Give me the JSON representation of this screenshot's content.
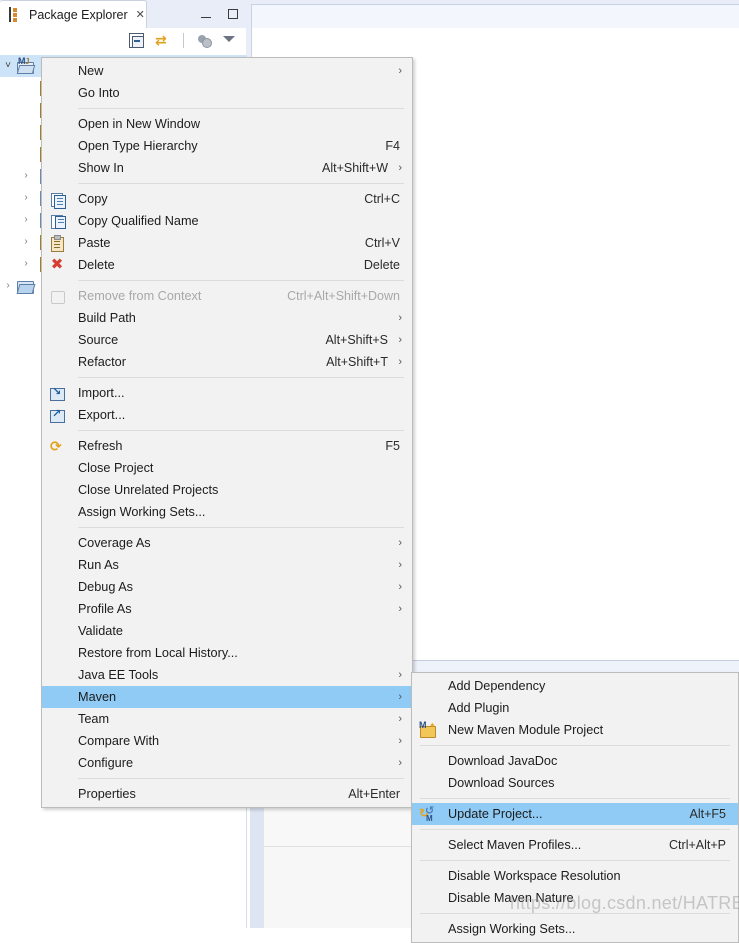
{
  "app": {
    "view_title": "Package Explorer",
    "view_tab_close": "✕",
    "minimize_label": "Minimize",
    "maximize_label": "Maximize"
  },
  "view_toolbar": {
    "items": [
      {
        "name": "collapse-all-icon",
        "tooltip": "Collapse All"
      },
      {
        "name": "link-with-editor-icon",
        "tooltip": "Link with Editor"
      },
      {
        "name": "focus-on-active-task-icon",
        "tooltip": "Focus on Active Task"
      },
      {
        "name": "view-menu-icon",
        "tooltip": "View Menu"
      }
    ]
  },
  "tree": {
    "rows": [
      {
        "indent": 0,
        "twisty": "v",
        "icon": "maven-java-project-icon",
        "label": "",
        "selected": true
      },
      {
        "indent": 1,
        "twisty": "",
        "icon": "source-folder-icon",
        "label": ""
      },
      {
        "indent": 1,
        "twisty": "",
        "icon": "source-folder-icon",
        "label": ""
      },
      {
        "indent": 1,
        "twisty": "",
        "icon": "source-folder-icon",
        "label": ""
      },
      {
        "indent": 1,
        "twisty": "",
        "icon": "source-folder-icon",
        "label": ""
      },
      {
        "indent": 1,
        "twisty": ">",
        "icon": "library-icon",
        "label": ""
      },
      {
        "indent": 1,
        "twisty": ">",
        "icon": "library-icon",
        "label": ""
      },
      {
        "indent": 1,
        "twisty": ">",
        "icon": "library-icon",
        "label": ""
      },
      {
        "indent": 1,
        "twisty": ">",
        "icon": "folder-icon",
        "label": ""
      },
      {
        "indent": 1,
        "twisty": ">",
        "icon": "folder-icon",
        "label": ""
      },
      {
        "indent": 0,
        "twisty": ">",
        "icon": "project-folder-icon",
        "label": ""
      }
    ]
  },
  "context_menu": {
    "name": "project-context-menu",
    "items": [
      {
        "id": "new",
        "label": "New",
        "accel": "",
        "arrow": true,
        "icon": "",
        "state": "normal"
      },
      {
        "id": "go-into",
        "label": "Go Into",
        "accel": "",
        "arrow": false,
        "icon": "",
        "state": "normal"
      },
      {
        "id": "sep1",
        "type": "separator"
      },
      {
        "id": "open-in-new-window",
        "label": "Open in New Window",
        "accel": "",
        "arrow": false,
        "icon": "",
        "state": "normal"
      },
      {
        "id": "open-type-hierarchy",
        "label": "Open Type Hierarchy",
        "accel": "F4",
        "arrow": false,
        "icon": "",
        "state": "normal"
      },
      {
        "id": "show-in",
        "label": "Show In",
        "accel": "Alt+Shift+W",
        "arrow": true,
        "icon": "",
        "state": "normal"
      },
      {
        "id": "sep2",
        "type": "separator"
      },
      {
        "id": "copy",
        "label": "Copy",
        "accel": "Ctrl+C",
        "arrow": false,
        "icon": "copy-icon",
        "state": "normal"
      },
      {
        "id": "copy-qualified-name",
        "label": "Copy Qualified Name",
        "accel": "",
        "arrow": false,
        "icon": "copy-qualified-name-icon",
        "state": "normal"
      },
      {
        "id": "paste",
        "label": "Paste",
        "accel": "Ctrl+V",
        "arrow": false,
        "icon": "paste-icon",
        "state": "normal"
      },
      {
        "id": "delete",
        "label": "Delete",
        "accel": "Delete",
        "arrow": false,
        "icon": "delete-icon",
        "state": "normal"
      },
      {
        "id": "sep3",
        "type": "separator"
      },
      {
        "id": "remove-from-context",
        "label": "Remove from Context",
        "accel": "Ctrl+Alt+Shift+Down",
        "arrow": false,
        "icon": "remove-from-context-icon",
        "state": "disabled"
      },
      {
        "id": "build-path",
        "label": "Build Path",
        "accel": "",
        "arrow": true,
        "icon": "",
        "state": "normal"
      },
      {
        "id": "source",
        "label": "Source",
        "accel": "Alt+Shift+S",
        "arrow": true,
        "icon": "",
        "state": "normal"
      },
      {
        "id": "refactor",
        "label": "Refactor",
        "accel": "Alt+Shift+T",
        "arrow": true,
        "icon": "",
        "state": "normal"
      },
      {
        "id": "sep4",
        "type": "separator"
      },
      {
        "id": "import",
        "label": "Import...",
        "accel": "",
        "arrow": false,
        "icon": "import-icon",
        "state": "normal"
      },
      {
        "id": "export",
        "label": "Export...",
        "accel": "",
        "arrow": false,
        "icon": "export-icon",
        "state": "normal"
      },
      {
        "id": "sep5",
        "type": "separator"
      },
      {
        "id": "refresh",
        "label": "Refresh",
        "accel": "F5",
        "arrow": false,
        "icon": "refresh-icon",
        "state": "normal"
      },
      {
        "id": "close-project",
        "label": "Close Project",
        "accel": "",
        "arrow": false,
        "icon": "",
        "state": "normal"
      },
      {
        "id": "close-unrelated",
        "label": "Close Unrelated Projects",
        "accel": "",
        "arrow": false,
        "icon": "",
        "state": "normal"
      },
      {
        "id": "assign-working-sets",
        "label": "Assign Working Sets...",
        "accel": "",
        "arrow": false,
        "icon": "",
        "state": "normal"
      },
      {
        "id": "sep6",
        "type": "separator"
      },
      {
        "id": "coverage-as",
        "label": "Coverage As",
        "accel": "",
        "arrow": true,
        "icon": "",
        "state": "normal"
      },
      {
        "id": "run-as",
        "label": "Run As",
        "accel": "",
        "arrow": true,
        "icon": "",
        "state": "normal"
      },
      {
        "id": "debug-as",
        "label": "Debug As",
        "accel": "",
        "arrow": true,
        "icon": "",
        "state": "normal"
      },
      {
        "id": "profile-as",
        "label": "Profile As",
        "accel": "",
        "arrow": true,
        "icon": "",
        "state": "normal"
      },
      {
        "id": "validate",
        "label": "Validate",
        "accel": "",
        "arrow": false,
        "icon": "",
        "state": "normal"
      },
      {
        "id": "restore-local-history",
        "label": "Restore from Local History...",
        "accel": "",
        "arrow": false,
        "icon": "",
        "state": "normal"
      },
      {
        "id": "java-ee-tools",
        "label": "Java EE Tools",
        "accel": "",
        "arrow": true,
        "icon": "",
        "state": "normal"
      },
      {
        "id": "maven",
        "label": "Maven",
        "accel": "",
        "arrow": true,
        "icon": "",
        "state": "selected"
      },
      {
        "id": "team",
        "label": "Team",
        "accel": "",
        "arrow": true,
        "icon": "",
        "state": "normal"
      },
      {
        "id": "compare-with",
        "label": "Compare With",
        "accel": "",
        "arrow": true,
        "icon": "",
        "state": "normal"
      },
      {
        "id": "configure",
        "label": "Configure",
        "accel": "",
        "arrow": true,
        "icon": "",
        "state": "normal"
      },
      {
        "id": "sep7",
        "type": "separator"
      },
      {
        "id": "properties",
        "label": "Properties",
        "accel": "Alt+Enter",
        "arrow": false,
        "icon": "",
        "state": "normal"
      }
    ]
  },
  "maven_submenu": {
    "name": "maven-submenu",
    "items": [
      {
        "id": "add-dependency",
        "label": "Add Dependency",
        "accel": "",
        "arrow": false,
        "icon": "",
        "state": "normal"
      },
      {
        "id": "add-plugin",
        "label": "Add Plugin",
        "accel": "",
        "arrow": false,
        "icon": "",
        "state": "normal"
      },
      {
        "id": "new-maven-module",
        "label": "New Maven Module Project",
        "accel": "",
        "arrow": false,
        "icon": "maven-module-icon",
        "state": "normal"
      },
      {
        "id": "msep1",
        "type": "separator"
      },
      {
        "id": "download-javadoc",
        "label": "Download JavaDoc",
        "accel": "",
        "arrow": false,
        "icon": "",
        "state": "normal"
      },
      {
        "id": "download-sources",
        "label": "Download Sources",
        "accel": "",
        "arrow": false,
        "icon": "",
        "state": "normal"
      },
      {
        "id": "msep2",
        "type": "separator"
      },
      {
        "id": "update-project",
        "label": "Update Project...",
        "accel": "Alt+F5",
        "arrow": false,
        "icon": "update-project-icon",
        "state": "selected"
      },
      {
        "id": "msep3",
        "type": "separator"
      },
      {
        "id": "select-maven-profiles",
        "label": "Select Maven Profiles...",
        "accel": "Ctrl+Alt+P",
        "arrow": false,
        "icon": "",
        "state": "normal"
      },
      {
        "id": "msep4",
        "type": "separator"
      },
      {
        "id": "disable-workspace-res",
        "label": "Disable Workspace Resolution",
        "accel": "",
        "arrow": false,
        "icon": "",
        "state": "normal"
      },
      {
        "id": "disable-maven-nature",
        "label": "Disable Maven Nature",
        "accel": "",
        "arrow": false,
        "icon": "",
        "state": "normal"
      },
      {
        "id": "msep5",
        "type": "separator"
      },
      {
        "id": "assign-working-sets-mvn",
        "label": "Assign Working Sets...",
        "accel": "",
        "arrow": false,
        "icon": "",
        "state": "normal"
      }
    ]
  },
  "watermark": {
    "text": "https://blog.csdn.net/HATREDQAQ"
  },
  "colors": {
    "menu_background": "#f2f2f2",
    "menu_border": "#bcbcbc",
    "selection_blue": "#8fcbf5",
    "tree_selection": "#cde3f7",
    "tab_area": "#e8edf7",
    "delete_red": "#d43f32",
    "maven_gold": "#e8a317"
  }
}
